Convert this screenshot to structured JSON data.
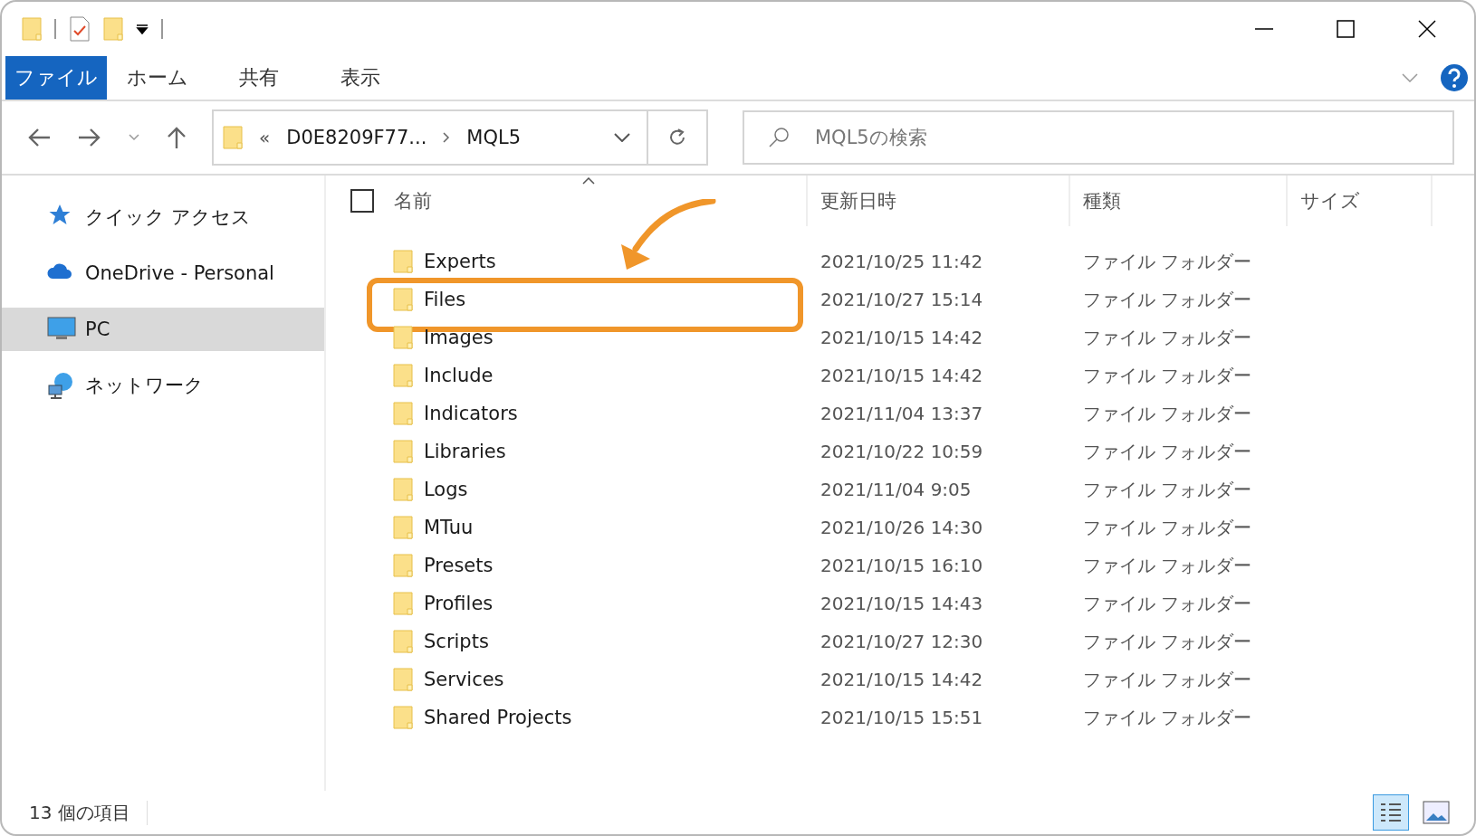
{
  "ribbon": {
    "tabs": [
      {
        "label": "ファイル",
        "selected": true
      },
      {
        "label": "ホーム",
        "selected": false
      },
      {
        "label": "共有",
        "selected": false
      },
      {
        "label": "表示",
        "selected": false
      }
    ]
  },
  "address_bar": {
    "overflow": "«",
    "segments": [
      "D0E8209F77...",
      "MQL5"
    ]
  },
  "search": {
    "placeholder": "MQL5の検索"
  },
  "navigation": {
    "items": [
      {
        "label": "クイック アクセス",
        "kind": "star",
        "selected": false
      },
      {
        "label": "OneDrive - Personal",
        "kind": "cloud",
        "selected": false
      },
      {
        "label": "PC",
        "kind": "pc",
        "selected": true
      },
      {
        "label": "ネットワーク",
        "kind": "network",
        "selected": false
      }
    ]
  },
  "table": {
    "select_all": {
      "checked": false
    },
    "columns": [
      "名前",
      "更新日時",
      "種類",
      "サイズ"
    ],
    "rows": [
      {
        "name": "Experts",
        "modified": "2021/10/25 11:42",
        "type": "ファイル フォルダー",
        "highlighted": false
      },
      {
        "name": "Files",
        "modified": "2021/10/27 15:14",
        "type": "ファイル フォルダー",
        "highlighted": true
      },
      {
        "name": "Images",
        "modified": "2021/10/15 14:42",
        "type": "ファイル フォルダー",
        "highlighted": false
      },
      {
        "name": "Include",
        "modified": "2021/10/15 14:42",
        "type": "ファイル フォルダー",
        "highlighted": false
      },
      {
        "name": "Indicators",
        "modified": "2021/11/04 13:37",
        "type": "ファイル フォルダー",
        "highlighted": false
      },
      {
        "name": "Libraries",
        "modified": "2021/10/22 10:59",
        "type": "ファイル フォルダー",
        "highlighted": false
      },
      {
        "name": "Logs",
        "modified": "2021/11/04 9:05",
        "type": "ファイル フォルダー",
        "highlighted": false
      },
      {
        "name": "MTuu",
        "modified": "2021/10/26 14:30",
        "type": "ファイル フォルダー",
        "highlighted": false
      },
      {
        "name": "Presets",
        "modified": "2021/10/15 16:10",
        "type": "ファイル フォルダー",
        "highlighted": false
      },
      {
        "name": "Profiles",
        "modified": "2021/10/15 14:43",
        "type": "ファイル フォルダー",
        "highlighted": false
      },
      {
        "name": "Scripts",
        "modified": "2021/10/27 12:30",
        "type": "ファイル フォルダー",
        "highlighted": false
      },
      {
        "name": "Services",
        "modified": "2021/10/15 14:42",
        "type": "ファイル フォルダー",
        "highlighted": false
      },
      {
        "name": "Shared Projects",
        "modified": "2021/10/15 15:51",
        "type": "ファイル フォルダー",
        "highlighted": false
      }
    ]
  },
  "status_bar": {
    "item_count": "13 個の項目",
    "view_buttons": [
      {
        "kind": "details",
        "selected": true
      },
      {
        "kind": "large_icons",
        "selected": false
      }
    ]
  }
}
